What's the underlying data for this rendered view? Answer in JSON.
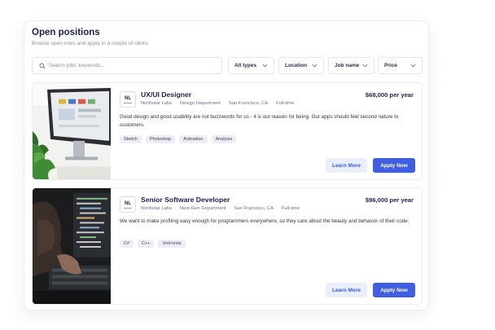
{
  "header": {
    "title": "Open positions",
    "subtitle": "Browse open roles and apply in a couple of clicks."
  },
  "search": {
    "placeholder": "Search jobs, keywords..."
  },
  "filters": [
    {
      "label": "All types"
    },
    {
      "label": "Location"
    },
    {
      "label": "Job name"
    },
    {
      "label": "Price"
    }
  ],
  "jobs": [
    {
      "logo": "NL",
      "title": "UX/UI Designer",
      "company": "Northstar Labs",
      "department": "Design Department",
      "location": "San Francisco, CA",
      "type": "Full-time",
      "salary": "$68,000 per year",
      "description": "Good design and good usability are not buzzwords for us - it is our reason for being. Our apps should feel second nature to customers.",
      "tags": [
        "Sketch",
        "Photoshop",
        "Animation",
        "Analysis"
      ],
      "learn_more": "Learn More",
      "apply": "Apply Now"
    },
    {
      "logo": "NL",
      "title": "Senior Software Developer",
      "company": "Northstar Labs",
      "department": "Next-Gen Department",
      "location": "San Francisco, CA",
      "type": "Full-time",
      "salary": "$96,000 per year",
      "description": "We want to make profiling easy enough for programmers everywhere, so they care about the beauty and behavior of their code.",
      "tags": [
        "C#",
        "C++",
        "Unit-tests"
      ],
      "learn_more": "Learn More",
      "apply": "Apply Now"
    }
  ]
}
